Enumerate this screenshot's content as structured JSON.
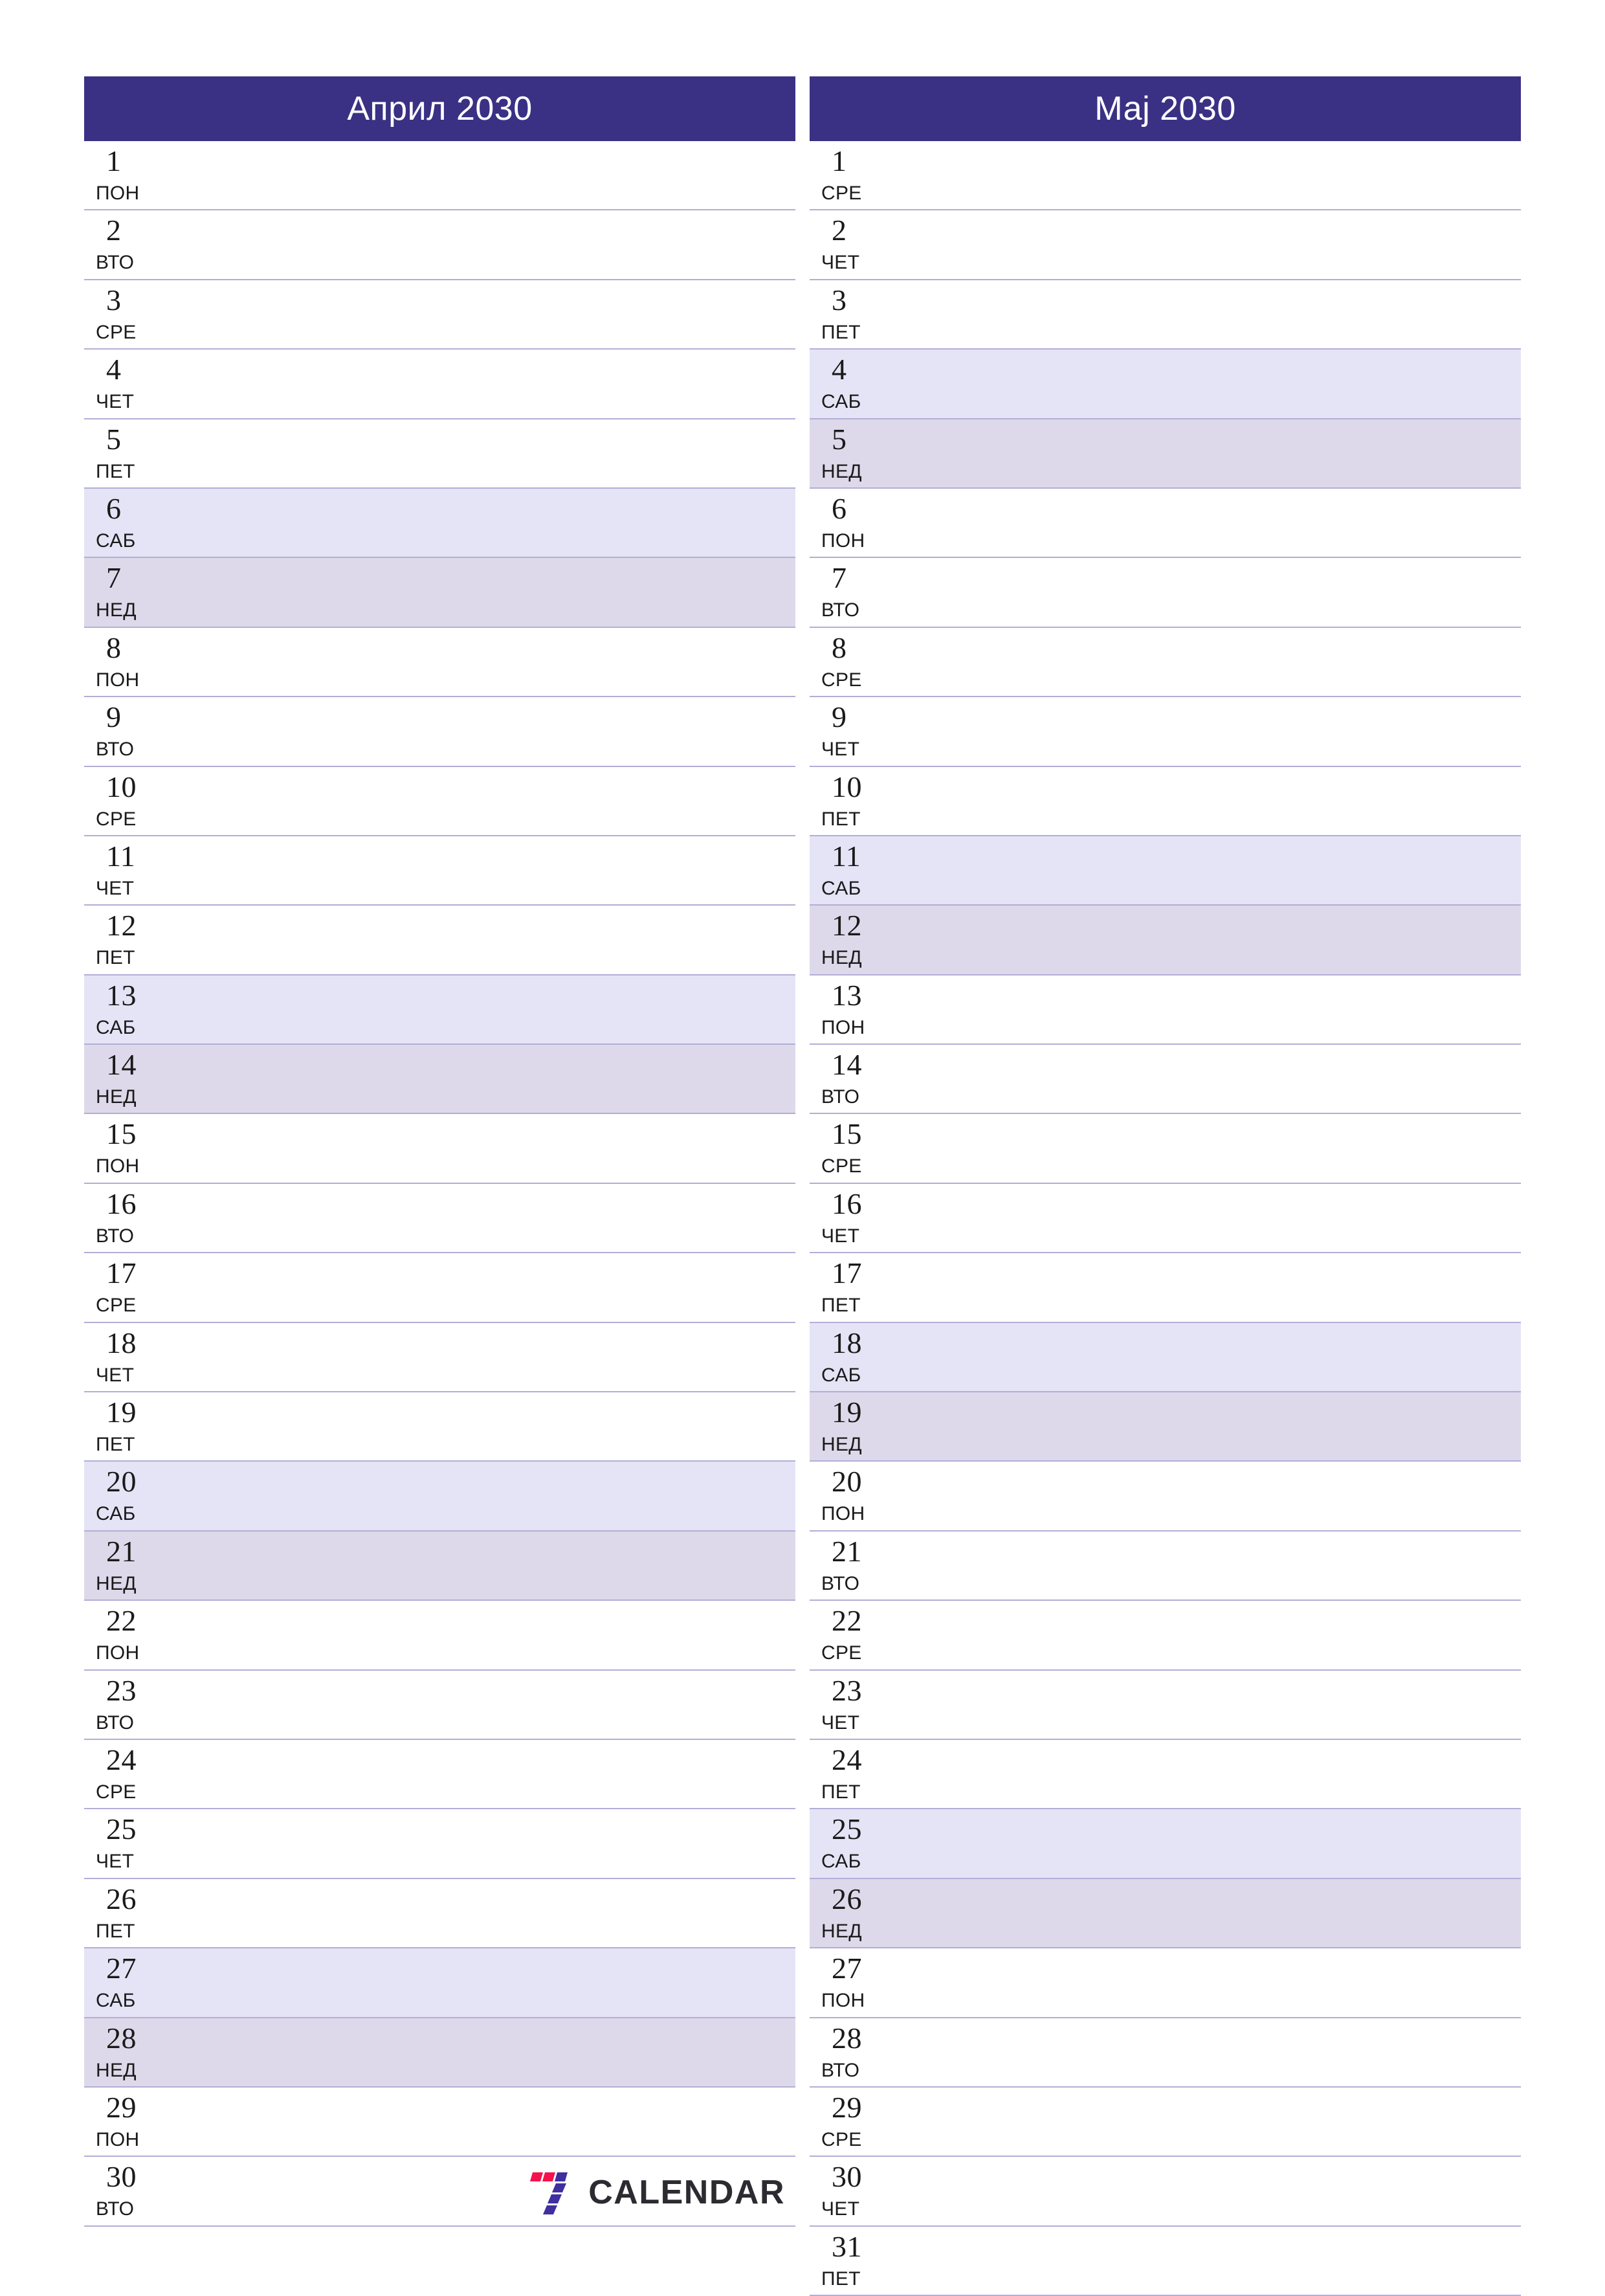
{
  "document": {
    "type": "two-month-planner",
    "orientation": "portrait",
    "locale": "mk",
    "week_start": "monday"
  },
  "colors": {
    "header_bar": "#3a3184",
    "header_text": "#ffffff",
    "row_separator": "#b3aed6",
    "saturday_fill": "#e5e4f6",
    "sunday_fill": "#ded9ea",
    "day_text": "#1a1a1a",
    "logo_red": "#f4134c",
    "logo_purple": "#3f2fa0",
    "logo_text": "#2b2b31"
  },
  "weekday_abbreviations": {
    "mon": "ПОН",
    "tue": "ВТО",
    "wed": "СРЕ",
    "thu": "ЧЕТ",
    "fri": "ПЕТ",
    "sat": "САБ",
    "sun": "НЕД"
  },
  "footer": {
    "logo_mark_name": "seven-calendar-logo",
    "logo_text": "CALENDAR"
  },
  "months": [
    {
      "id": "april-2030",
      "title": "Април 2030",
      "days": [
        {
          "n": "1",
          "wd": "ПОН",
          "type": "weekday"
        },
        {
          "n": "2",
          "wd": "ВТО",
          "type": "weekday"
        },
        {
          "n": "3",
          "wd": "СРЕ",
          "type": "weekday"
        },
        {
          "n": "4",
          "wd": "ЧЕТ",
          "type": "weekday"
        },
        {
          "n": "5",
          "wd": "ПЕТ",
          "type": "weekday"
        },
        {
          "n": "6",
          "wd": "САБ",
          "type": "saturday"
        },
        {
          "n": "7",
          "wd": "НЕД",
          "type": "sunday"
        },
        {
          "n": "8",
          "wd": "ПОН",
          "type": "weekday"
        },
        {
          "n": "9",
          "wd": "ВТО",
          "type": "weekday"
        },
        {
          "n": "10",
          "wd": "СРЕ",
          "type": "weekday"
        },
        {
          "n": "11",
          "wd": "ЧЕТ",
          "type": "weekday"
        },
        {
          "n": "12",
          "wd": "ПЕТ",
          "type": "weekday"
        },
        {
          "n": "13",
          "wd": "САБ",
          "type": "saturday"
        },
        {
          "n": "14",
          "wd": "НЕД",
          "type": "sunday"
        },
        {
          "n": "15",
          "wd": "ПОН",
          "type": "weekday"
        },
        {
          "n": "16",
          "wd": "ВТО",
          "type": "weekday"
        },
        {
          "n": "17",
          "wd": "СРЕ",
          "type": "weekday"
        },
        {
          "n": "18",
          "wd": "ЧЕТ",
          "type": "weekday"
        },
        {
          "n": "19",
          "wd": "ПЕТ",
          "type": "weekday"
        },
        {
          "n": "20",
          "wd": "САБ",
          "type": "saturday"
        },
        {
          "n": "21",
          "wd": "НЕД",
          "type": "sunday"
        },
        {
          "n": "22",
          "wd": "ПОН",
          "type": "weekday"
        },
        {
          "n": "23",
          "wd": "ВТО",
          "type": "weekday"
        },
        {
          "n": "24",
          "wd": "СРЕ",
          "type": "weekday"
        },
        {
          "n": "25",
          "wd": "ЧЕТ",
          "type": "weekday"
        },
        {
          "n": "26",
          "wd": "ПЕТ",
          "type": "weekday"
        },
        {
          "n": "27",
          "wd": "САБ",
          "type": "saturday"
        },
        {
          "n": "28",
          "wd": "НЕД",
          "type": "sunday"
        },
        {
          "n": "29",
          "wd": "ПОН",
          "type": "weekday"
        },
        {
          "n": "30",
          "wd": "ВТО",
          "type": "weekday"
        }
      ]
    },
    {
      "id": "may-2030",
      "title": "Мај 2030",
      "days": [
        {
          "n": "1",
          "wd": "СРЕ",
          "type": "weekday"
        },
        {
          "n": "2",
          "wd": "ЧЕТ",
          "type": "weekday"
        },
        {
          "n": "3",
          "wd": "ПЕТ",
          "type": "weekday"
        },
        {
          "n": "4",
          "wd": "САБ",
          "type": "saturday"
        },
        {
          "n": "5",
          "wd": "НЕД",
          "type": "sunday"
        },
        {
          "n": "6",
          "wd": "ПОН",
          "type": "weekday"
        },
        {
          "n": "7",
          "wd": "ВТО",
          "type": "weekday"
        },
        {
          "n": "8",
          "wd": "СРЕ",
          "type": "weekday"
        },
        {
          "n": "9",
          "wd": "ЧЕТ",
          "type": "weekday"
        },
        {
          "n": "10",
          "wd": "ПЕТ",
          "type": "weekday"
        },
        {
          "n": "11",
          "wd": "САБ",
          "type": "saturday"
        },
        {
          "n": "12",
          "wd": "НЕД",
          "type": "sunday"
        },
        {
          "n": "13",
          "wd": "ПОН",
          "type": "weekday"
        },
        {
          "n": "14",
          "wd": "ВТО",
          "type": "weekday"
        },
        {
          "n": "15",
          "wd": "СРЕ",
          "type": "weekday"
        },
        {
          "n": "16",
          "wd": "ЧЕТ",
          "type": "weekday"
        },
        {
          "n": "17",
          "wd": "ПЕТ",
          "type": "weekday"
        },
        {
          "n": "18",
          "wd": "САБ",
          "type": "saturday"
        },
        {
          "n": "19",
          "wd": "НЕД",
          "type": "sunday"
        },
        {
          "n": "20",
          "wd": "ПОН",
          "type": "weekday"
        },
        {
          "n": "21",
          "wd": "ВТО",
          "type": "weekday"
        },
        {
          "n": "22",
          "wd": "СРЕ",
          "type": "weekday"
        },
        {
          "n": "23",
          "wd": "ЧЕТ",
          "type": "weekday"
        },
        {
          "n": "24",
          "wd": "ПЕТ",
          "type": "weekday"
        },
        {
          "n": "25",
          "wd": "САБ",
          "type": "saturday"
        },
        {
          "n": "26",
          "wd": "НЕД",
          "type": "sunday"
        },
        {
          "n": "27",
          "wd": "ПОН",
          "type": "weekday"
        },
        {
          "n": "28",
          "wd": "ВТО",
          "type": "weekday"
        },
        {
          "n": "29",
          "wd": "СРЕ",
          "type": "weekday"
        },
        {
          "n": "30",
          "wd": "ЧЕТ",
          "type": "weekday"
        },
        {
          "n": "31",
          "wd": "ПЕТ",
          "type": "weekday"
        }
      ]
    }
  ]
}
